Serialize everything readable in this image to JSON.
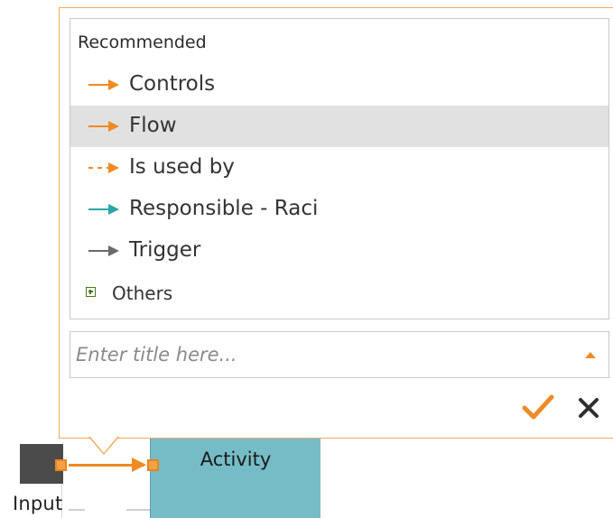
{
  "popup": {
    "section_title": "Recommended",
    "items": [
      {
        "label": "Controls",
        "icon": "solid-arrow-icon",
        "color": "#f08a24",
        "style": "solid",
        "selected": false
      },
      {
        "label": "Flow",
        "icon": "solid-arrow-icon",
        "color": "#f08a24",
        "style": "solid",
        "selected": true
      },
      {
        "label": "Is used by",
        "icon": "dashed-arrow-icon",
        "color": "#f08a24",
        "style": "dashed",
        "selected": false
      },
      {
        "label": "Responsible - Raci",
        "icon": "solid-arrow-icon",
        "color": "#2aa6a6",
        "style": "solid",
        "selected": false
      },
      {
        "label": "Trigger",
        "icon": "solid-arrow-icon",
        "color": "#6a6a6a",
        "style": "solid",
        "selected": false
      }
    ],
    "others_label": "Others",
    "title_placeholder": "Enter title here...",
    "title_value": "",
    "accent_color": "#f08a24",
    "confirm_icon": "checkmark-icon",
    "cancel_icon": "close-icon"
  },
  "diagram": {
    "input_label": "Input",
    "activity_label": "Activity",
    "activity_color": "#76bcc6"
  }
}
